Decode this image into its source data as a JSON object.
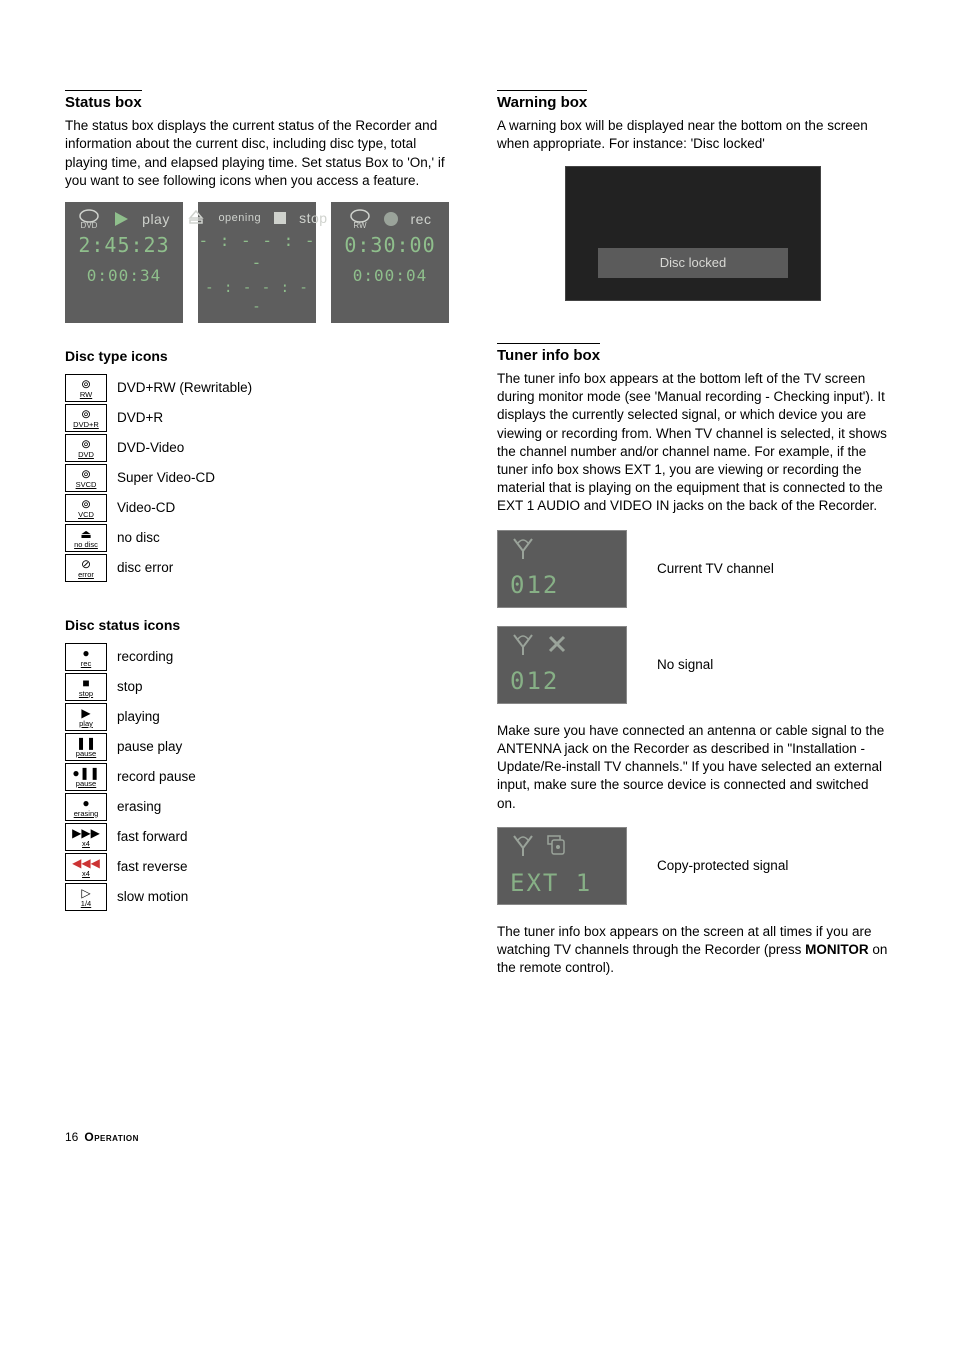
{
  "left": {
    "status_box": {
      "title": "Status box",
      "body": "The status box displays the current status of the Recorder and information about the current disc, including disc type, total playing time, and elapsed playing time. Set status Box to 'On,' if you want to see following icons when you access a feature.",
      "boxes": [
        {
          "iconTop": "DVD",
          "label": "play",
          "time1": "2:45:23",
          "time2": "0:00:34"
        },
        {
          "iconTop": "opening",
          "label": "stop",
          "time1": "- : - - : - -",
          "time2": "- : - - : - -"
        },
        {
          "iconTop": "RW",
          "label": "rec",
          "time1": "0:30:00",
          "time2": "0:00:04"
        }
      ]
    },
    "disc_type": {
      "heading": "Disc type icons",
      "rows": [
        {
          "g": "⊚",
          "t": "RW",
          "label": "DVD+RW (Rewritable)"
        },
        {
          "g": "⊚",
          "t": "DVD+R",
          "label": "DVD+R"
        },
        {
          "g": "⊚",
          "t": "DVD",
          "label": "DVD-Video"
        },
        {
          "g": "⊚",
          "t": "SVCD",
          "label": "Super Video-CD"
        },
        {
          "g": "⊚",
          "t": "VCD",
          "label": "Video-CD"
        },
        {
          "g": "⏏",
          "t": "no disc",
          "label": "no disc"
        },
        {
          "g": "⊘",
          "t": "error",
          "label": "disc error"
        }
      ]
    },
    "disc_status": {
      "heading": "Disc status icons",
      "rows": [
        {
          "g": "●",
          "t": "rec",
          "label": "recording"
        },
        {
          "g": "■",
          "t": "stop",
          "label": "stop"
        },
        {
          "g": "▶",
          "t": "play",
          "label": "playing"
        },
        {
          "g": "❚❚",
          "t": "pause",
          "label": "pause play"
        },
        {
          "g": "●❚❚",
          "t": "pause",
          "label": "record pause"
        },
        {
          "g": "●",
          "t": "erasing",
          "label": "erasing"
        },
        {
          "g": "▶▶▶",
          "t": "x4",
          "label": "fast forward"
        },
        {
          "g": "◀◀◀",
          "t": "x4",
          "label": "fast reverse"
        },
        {
          "g": "▷",
          "t": "1/4",
          "label": "slow motion"
        }
      ]
    }
  },
  "right": {
    "warning": {
      "title": "Warning box",
      "body": "A warning box will be displayed near the bottom on the screen when appropriate. For instance: 'Disc locked'",
      "banner": "Disc locked"
    },
    "tuner": {
      "title": "Tuner info box",
      "body1": "The tuner info box appears at the bottom left of the TV screen during monitor mode (see 'Manual recording - Checking input'). It displays the currently selected signal, or which device you are viewing or recording from. When TV channel is selected, it shows the channel number and/or channel name. For example, if the tuner info box shows EXT 1, you are viewing or recording the material that is playing on the equipment that is connected to the EXT 1 AUDIO and VIDEO IN jacks on the back of the Recorder.",
      "rows": [
        {
          "value": "012",
          "extra": "",
          "label": "Current TV channel"
        },
        {
          "value": "012",
          "extra": "nosig",
          "label": "No signal"
        }
      ],
      "body2": "Make sure you have connected an antenna or cable signal to the ANTENNA jack on the Recorder as described in \"Installation - Update/Re-install TV channels.\" If you have selected an external input, make sure the source device is connected and switched on.",
      "rows2": [
        {
          "value": "EXT 1",
          "extra": "copy",
          "label": "Copy-protected signal"
        }
      ],
      "body3a": "The tuner info box appears on the screen at all times if you are watching TV channels through the Recorder (press ",
      "body3_bold": "MONITOR",
      "body3b": " on the remote control)."
    }
  },
  "footer": {
    "page": "16",
    "section": "Operation"
  }
}
